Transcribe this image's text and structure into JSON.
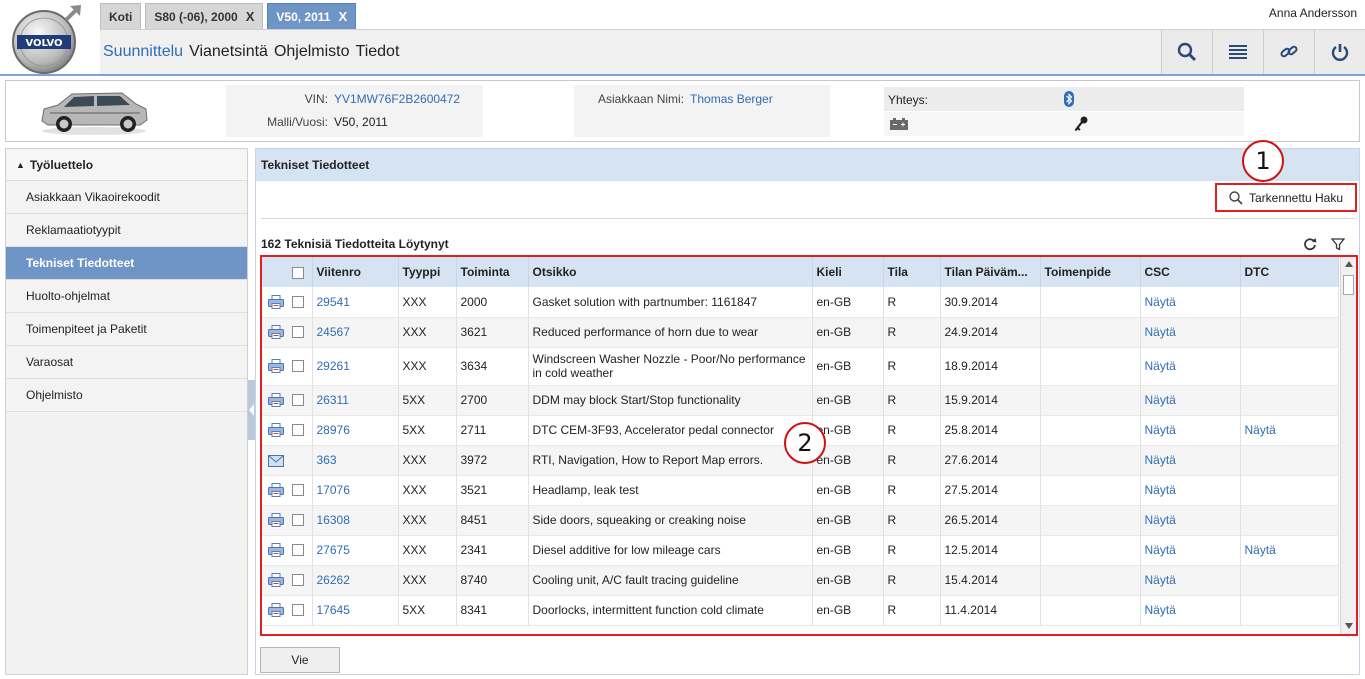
{
  "user": {
    "name": "Anna Andersson"
  },
  "brand": {
    "logo_text": "VOLVO",
    "accent": "#6f95c7",
    "link": "#2f6db5",
    "highlight": "#e02020"
  },
  "tabs": [
    {
      "label": "Koti",
      "closable": false,
      "active": false
    },
    {
      "label": "S80 (-06), 2000",
      "closable": true,
      "active": false
    },
    {
      "label": "V50, 2011",
      "closable": true,
      "active": true
    }
  ],
  "close_symbol": "X",
  "nav": {
    "items": [
      "Suunnittelu",
      "Vianetsintä",
      "Ohjelmisto",
      "Tiedot"
    ],
    "active_index": 0,
    "tools": [
      "search-icon",
      "list-icon",
      "link-icon",
      "power-icon"
    ]
  },
  "vehicle": {
    "vin_label": "VIN:",
    "vin": "YV1MW76F2B2600472",
    "model_label": "Malli/Vuosi:",
    "model": "V50, 2011",
    "customer_label": "Asiakkaan Nimi:",
    "customer": "Thomas Berger",
    "connection_label": "Yhteys:"
  },
  "sidebar": {
    "title": "Työluettelo",
    "items": [
      {
        "label": "Asiakkaan Vikaoirekoodit",
        "active": false
      },
      {
        "label": "Reklamaatiotyypit",
        "active": false
      },
      {
        "label": "Tekniset Tiedotteet",
        "active": true
      },
      {
        "label": "Huolto-ohjelmat",
        "active": false
      },
      {
        "label": "Toimenpiteet ja Paketit",
        "active": false
      },
      {
        "label": "Varaosat",
        "active": false
      },
      {
        "label": "Ohjelmisto",
        "active": false
      }
    ]
  },
  "main": {
    "title": "Tekniset Tiedotteet",
    "search_label": "Tarkennettu Haku",
    "count": "162",
    "count_label": "Teknisiä Tiedotteita Löytynyt",
    "export_label": "Vie"
  },
  "grid": {
    "columns": [
      "Viitenro",
      "Tyyppi",
      "Toiminta",
      "Otsikko",
      "Kieli",
      "Tila",
      "Tilan Päiväm...",
      "Toimenpide",
      "CSC",
      "DTC"
    ],
    "rows": [
      {
        "ref": "29541",
        "type": "XXX",
        "op": "2000",
        "title": "Gasket solution with partnumber: 1161847",
        "lang": "en-GB",
        "status": "R",
        "date": "30.9.2014",
        "action": "",
        "csc": "Näytä",
        "dtc": "",
        "icon": "printer",
        "checkbox": true
      },
      {
        "ref": "24567",
        "type": "XXX",
        "op": "3621",
        "title": "Reduced performance of horn due to wear",
        "lang": "en-GB",
        "status": "R",
        "date": "24.9.2014",
        "action": "",
        "csc": "Näytä",
        "dtc": "",
        "icon": "printer",
        "checkbox": true
      },
      {
        "ref": "29261",
        "type": "XXX",
        "op": "3634",
        "title": "Windscreen Washer Nozzle - Poor/No performance in cold weather",
        "lang": "en-GB",
        "status": "R",
        "date": "18.9.2014",
        "action": "",
        "csc": "Näytä",
        "dtc": "",
        "icon": "printer",
        "checkbox": true
      },
      {
        "ref": "26311",
        "type": "5XX",
        "op": "2700",
        "title": "DDM may block Start/Stop functionality",
        "lang": "en-GB",
        "status": "R",
        "date": "15.9.2014",
        "action": "",
        "csc": "Näytä",
        "dtc": "",
        "icon": "printer",
        "checkbox": true
      },
      {
        "ref": "28976",
        "type": "5XX",
        "op": "2711",
        "title": "DTC CEM-3F93, Accelerator pedal connector",
        "lang": "en-GB",
        "status": "R",
        "date": "25.8.2014",
        "action": "",
        "csc": "Näytä",
        "dtc": "Näytä",
        "icon": "printer",
        "checkbox": true
      },
      {
        "ref": "363",
        "type": "XXX",
        "op": "3972",
        "title": "RTI, Navigation, How to Report Map errors.",
        "lang": "en-GB",
        "status": "R",
        "date": "27.6.2014",
        "action": "",
        "csc": "Näytä",
        "dtc": "",
        "icon": "mail",
        "checkbox": false
      },
      {
        "ref": "17076",
        "type": "XXX",
        "op": "3521",
        "title": "Headlamp, leak test",
        "lang": "en-GB",
        "status": "R",
        "date": "27.5.2014",
        "action": "",
        "csc": "Näytä",
        "dtc": "",
        "icon": "printer",
        "checkbox": true
      },
      {
        "ref": "16308",
        "type": "XXX",
        "op": "8451",
        "title": "Side doors, squeaking or creaking noise",
        "lang": "en-GB",
        "status": "R",
        "date": "26.5.2014",
        "action": "",
        "csc": "Näytä",
        "dtc": "",
        "icon": "printer",
        "checkbox": true
      },
      {
        "ref": "27675",
        "type": "XXX",
        "op": "2341",
        "title": "Diesel additive for low mileage cars",
        "lang": "en-GB",
        "status": "R",
        "date": "12.5.2014",
        "action": "",
        "csc": "Näytä",
        "dtc": "Näytä",
        "icon": "printer",
        "checkbox": true
      },
      {
        "ref": "26262",
        "type": "XXX",
        "op": "8740",
        "title": "Cooling unit, A/C fault tracing guideline",
        "lang": "en-GB",
        "status": "R",
        "date": "15.4.2014",
        "action": "",
        "csc": "Näytä",
        "dtc": "",
        "icon": "printer",
        "checkbox": true
      },
      {
        "ref": "17645",
        "type": "5XX",
        "op": "8341",
        "title": "Doorlocks, intermittent function cold climate",
        "lang": "en-GB",
        "status": "R",
        "date": "11.4.2014",
        "action": "",
        "csc": "Näytä",
        "dtc": "",
        "icon": "printer",
        "checkbox": true
      }
    ]
  },
  "callouts": [
    "1",
    "2"
  ]
}
